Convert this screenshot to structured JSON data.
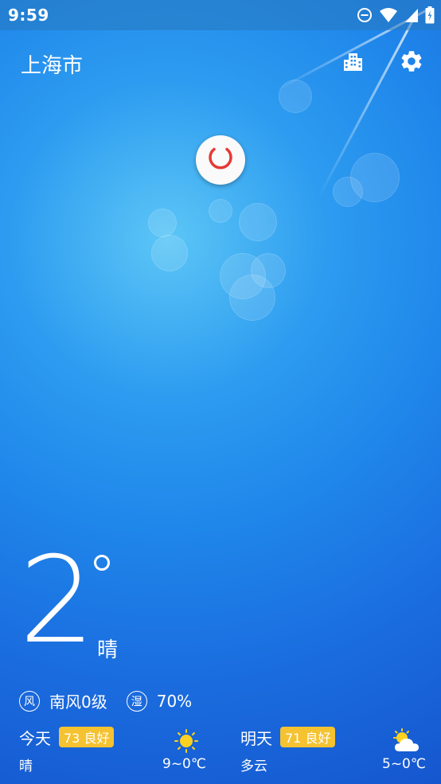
{
  "status_bar": {
    "time": "9:59",
    "icons": [
      "do-not-disturb-icon",
      "wifi-icon",
      "signal-icon",
      "battery-charging-icon"
    ]
  },
  "header": {
    "city": "上海市",
    "city_list_icon": "city-buildings-icon",
    "settings_icon": "settings-gear-icon"
  },
  "loading": {
    "indicator_color": "#e53935"
  },
  "current": {
    "temperature": "2",
    "degree_symbol": "°",
    "condition": "晴",
    "wind_icon_label": "风",
    "wind": "南风0级",
    "humidity_icon_label": "湿",
    "humidity": "70%"
  },
  "forecast": [
    {
      "day": "今天",
      "aqi": "73 良好",
      "condition": "晴",
      "temp_range": "9~0℃",
      "icon": "sunny-icon"
    },
    {
      "day": "明天",
      "aqi": "71 良好",
      "condition": "多云",
      "temp_range": "5~0℃",
      "icon": "partly-cloudy-icon"
    }
  ],
  "colors": {
    "aqi_badge": "#f5c231",
    "background_top": "#5cc6f6",
    "background_bottom": "#1556cf",
    "sun": "#ffd21f"
  }
}
